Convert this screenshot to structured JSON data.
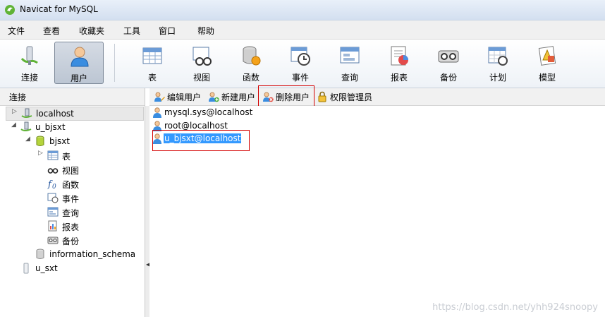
{
  "window": {
    "title": "Navicat for MySQL"
  },
  "menu": [
    "文件",
    "查看",
    "收藏夹",
    "工具",
    "窗口",
    "帮助"
  ],
  "toolbar": {
    "buttons": [
      {
        "label": "连接",
        "icon": "connection-icon"
      },
      {
        "label": "用户",
        "icon": "user-icon",
        "active": true
      },
      {
        "label": "表",
        "icon": "table-icon"
      },
      {
        "label": "视图",
        "icon": "view-icon"
      },
      {
        "label": "函数",
        "icon": "function-icon"
      },
      {
        "label": "事件",
        "icon": "event-icon"
      },
      {
        "label": "查询",
        "icon": "query-icon"
      },
      {
        "label": "报表",
        "icon": "report-icon"
      },
      {
        "label": "备份",
        "icon": "backup-icon"
      },
      {
        "label": "计划",
        "icon": "schedule-icon"
      },
      {
        "label": "模型",
        "icon": "model-icon"
      }
    ]
  },
  "left": {
    "header": "连接",
    "tree": [
      {
        "label": "localhost",
        "icon": "connection-icon",
        "expander": "▷"
      },
      {
        "label": "u_bjsxt",
        "icon": "connection-open-icon",
        "expander": "◢"
      },
      {
        "label": "bjsxt",
        "icon": "database-open-icon",
        "expander": "◢"
      },
      {
        "label": "表",
        "icon": "table-icon",
        "expander": "▷"
      },
      {
        "label": "视图",
        "icon": "view-icon"
      },
      {
        "label": "函数",
        "icon": "function-icon"
      },
      {
        "label": "事件",
        "icon": "event-icon"
      },
      {
        "label": "查询",
        "icon": "query-icon"
      },
      {
        "label": "报表",
        "icon": "report-icon"
      },
      {
        "label": "备份",
        "icon": "backup-icon"
      },
      {
        "label": "information_schema",
        "icon": "database-icon"
      },
      {
        "label": "u_sxt",
        "icon": "connection-closed-icon"
      }
    ]
  },
  "object_toolbar": {
    "edit_user": "编辑用户",
    "new_user": "新建用户",
    "delete_user": "删除用户",
    "privilege_manager": "权限管理员"
  },
  "users": [
    {
      "name": "mysql.sys@localhost"
    },
    {
      "name": "root@localhost"
    },
    {
      "name": "u_bjsxt@localhost",
      "selected": true
    }
  ],
  "watermark": "https://blog.csdn.net/yhh924snoopy",
  "colors": {
    "selection": "#3399ff",
    "highlight_box": "#d40000"
  }
}
